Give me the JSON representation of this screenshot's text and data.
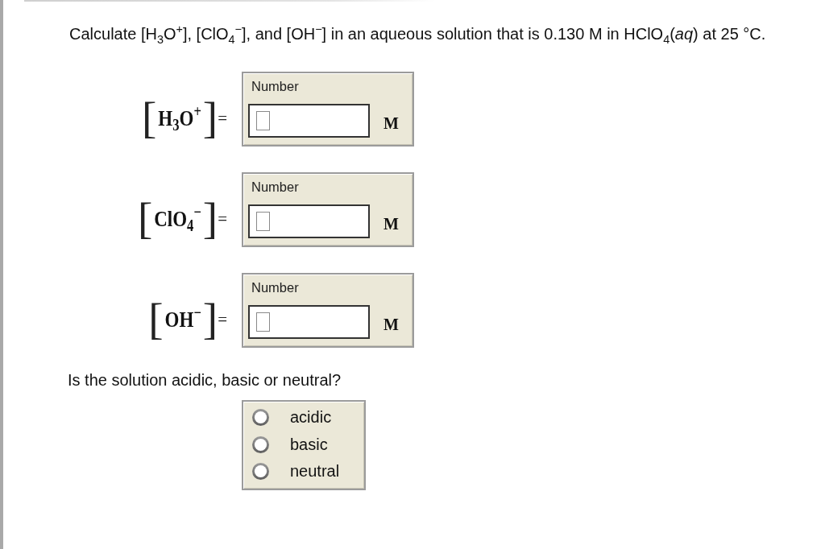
{
  "question": "Calculate [H$_{3}$O$^{+}$], [ClO$_{4}$$^{−}$], and [OH$^{−}$] in an aqueous solution that is 0.130 M in HClO$_{4}$(*aq*) at 25 °C.",
  "answer_rows": [
    {
      "left_bracket": "[",
      "species": "H$_{3}$O$^{+}$",
      "right_bracket": "]",
      "equals": "=",
      "field_label": "Number",
      "unit": "M"
    },
    {
      "left_bracket": "[",
      "species": "ClO$_{4}$$^{−}$",
      "right_bracket": "]",
      "equals": "=",
      "field_label": "Number",
      "unit": "M"
    },
    {
      "left_bracket": "[",
      "species": "OH$^{−}$",
      "right_bracket": "]",
      "equals": "=",
      "field_label": "Number",
      "unit": "M"
    }
  ],
  "question_2": "Is the solution acidic, basic or neutral?",
  "choices": [
    {
      "label": "acidic",
      "selected": false
    },
    {
      "label": "basic",
      "selected": false
    },
    {
      "label": "neutral",
      "selected": false
    }
  ]
}
